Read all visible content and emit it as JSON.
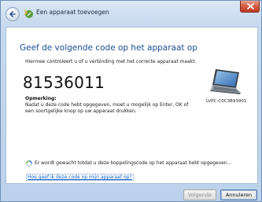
{
  "window": {
    "title": "Een apparaat toevoegen"
  },
  "main": {
    "heading": "Geef de volgende code op het apparaat op",
    "intro": "Hiermee controleert u of u verbinding met het correcte apparaat maakt.",
    "pairing_code": "81536011",
    "note_title": "Opmerking:",
    "note_text": "Nadat u deze code hebt opgegeven, moet u mogelijk op Enter, OK of een soortgelijke knop op uw apparaat drukken.",
    "device_name": "LVPC-C0C3B93901",
    "wait_text": "Er wordt gewacht totdat u deze koppelingscode op het apparaat hebt opgegeven...",
    "help_link": "Hoe geef ik deze code op mijn apparaat op?"
  },
  "footer": {
    "next_label": "Volgende",
    "cancel_label": "Annuleren"
  },
  "icons": {
    "back": "back-arrow-icon",
    "title": "bluetooth-device-icon",
    "close": "close-icon",
    "device": "laptop-icon",
    "wait": "busy-spinner-icon"
  },
  "colors": {
    "heading": "#1a4f96",
    "link": "#0b5ec8",
    "close_button": "#c13a23"
  }
}
